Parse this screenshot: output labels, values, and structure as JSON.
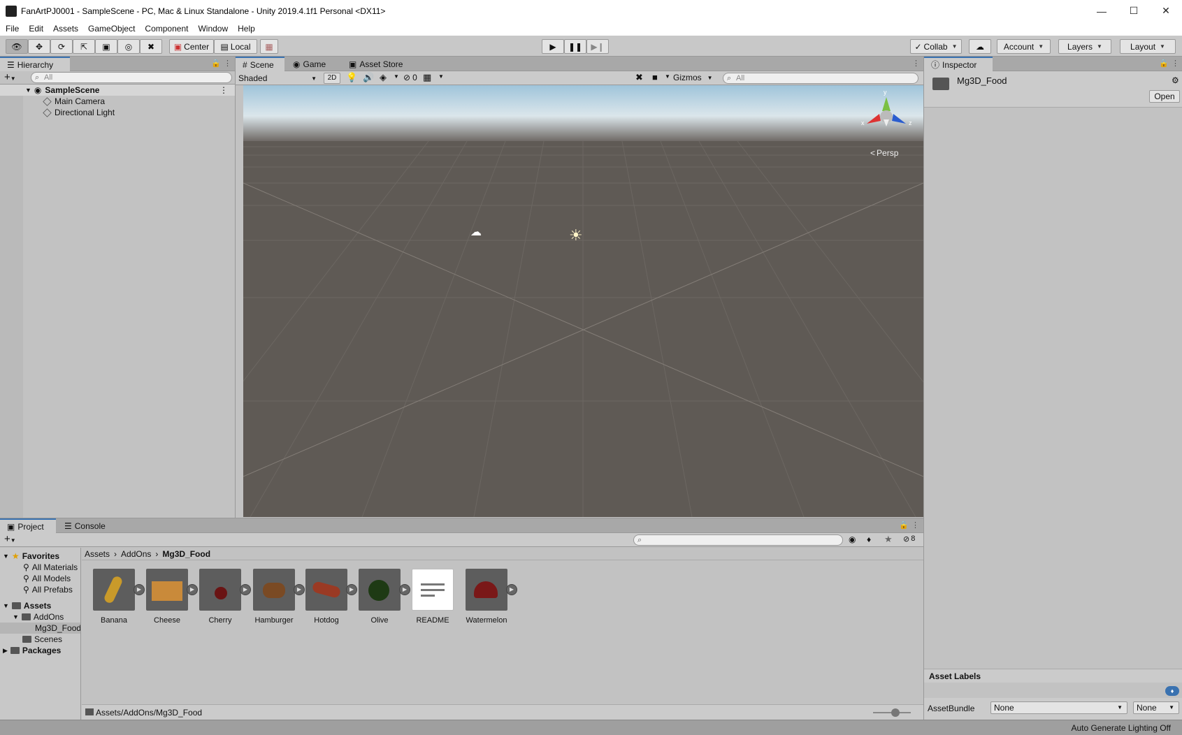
{
  "window": {
    "title": "FanArtPJ0001 - SampleScene - PC, Mac & Linux Standalone - Unity 2019.4.1f1 Personal <DX11>"
  },
  "menu": [
    "File",
    "Edit",
    "Assets",
    "GameObject",
    "Component",
    "Window",
    "Help"
  ],
  "toolbar": {
    "pivot_label": "Center",
    "space_label": "Local",
    "collab_label": "Collab",
    "account_label": "Account",
    "layers_label": "Layers",
    "layout_label": "Layout"
  },
  "hierarchy": {
    "tab": "Hierarchy",
    "search_placeholder": "All",
    "scene": "SampleScene",
    "items": [
      "Main Camera",
      "Directional Light"
    ]
  },
  "scene": {
    "tabs": [
      "Scene",
      "Game",
      "Asset Store"
    ],
    "shading": "Shaded",
    "mode_2d": "2D",
    "hidden_count": "0",
    "gizmos_label": "Gizmos",
    "search_placeholder": "All",
    "persp_label": "Persp",
    "axis": {
      "y": "y",
      "x": "x",
      "z": "z"
    }
  },
  "inspector": {
    "tab": "Inspector",
    "object_name": "Mg3D_Food",
    "open_label": "Open",
    "asset_labels_title": "Asset Labels",
    "assetbundle_label": "AssetBundle",
    "assetbundle_value": "None",
    "variant_value": "None"
  },
  "project": {
    "tabs": [
      "Project",
      "Console"
    ],
    "hidden_count": "8",
    "favorites": {
      "label": "Favorites",
      "items": [
        "All Materials",
        "All Models",
        "All Prefabs"
      ]
    },
    "assets_tree": {
      "label": "Assets",
      "addons": "AddOns",
      "mg3d": "Mg3D_Food",
      "scenes": "Scenes"
    },
    "packages": "Packages",
    "breadcrumb": [
      "Assets",
      "AddOns",
      "Mg3D_Food"
    ],
    "assets": [
      {
        "name": "Banana",
        "color": "#c99a2a"
      },
      {
        "name": "Cheese",
        "color": "#c98a3a"
      },
      {
        "name": "Cherry",
        "color": "#6a1414"
      },
      {
        "name": "Hamburger",
        "color": "#7a4a24"
      },
      {
        "name": "Hotdog",
        "color": "#9a3a24"
      },
      {
        "name": "Olive",
        "color": "#1e3a14"
      },
      {
        "name": "README",
        "color": "#ffffff"
      },
      {
        "name": "Watermelon",
        "color": "#7a1818"
      }
    ],
    "path": "Assets/AddOns/Mg3D_Food"
  },
  "status": {
    "text": "Auto Generate Lighting Off"
  }
}
